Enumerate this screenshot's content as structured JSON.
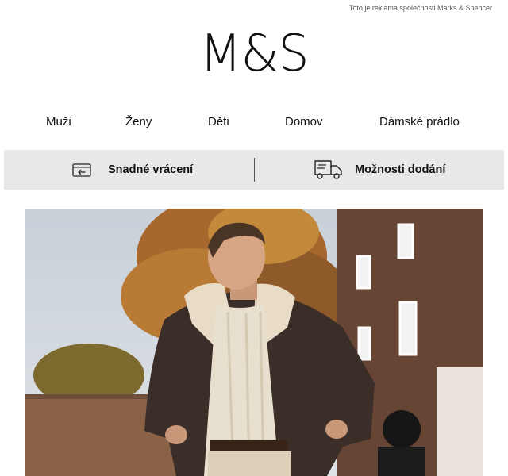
{
  "ad_notice": "Toto je reklama společnosti Marks & Spencer",
  "logo": "M&S",
  "nav": {
    "items": [
      {
        "label": "Muži"
      },
      {
        "label": "Ženy"
      },
      {
        "label": "Děti"
      },
      {
        "label": "Domov"
      },
      {
        "label": "Dámské prádlo"
      }
    ]
  },
  "services": {
    "returns": {
      "label": "Snadné vrácení",
      "icon": "return-card-icon"
    },
    "delivery": {
      "label": "Možnosti dodání",
      "icon": "delivery-truck-icon"
    }
  },
  "hero": {
    "alt": "Muž v kožené bundě s kožešinovým límcem a krémovém svetru"
  }
}
